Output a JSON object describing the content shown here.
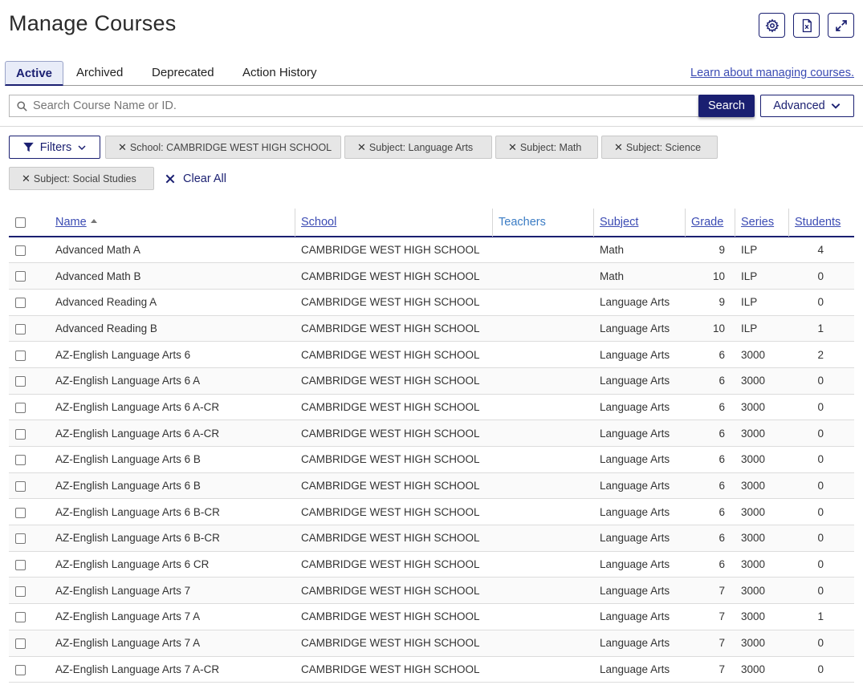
{
  "header": {
    "title": "Manage Courses"
  },
  "tabs": [
    {
      "label": "Active",
      "active": true
    },
    {
      "label": "Archived",
      "active": false
    },
    {
      "label": "Deprecated",
      "active": false
    },
    {
      "label": "Action History",
      "active": false
    }
  ],
  "learn_link": "Learn about managing courses.",
  "search": {
    "placeholder": "Search Course Name or ID.",
    "value": "",
    "button": "Search",
    "advanced": "Advanced"
  },
  "filters": {
    "button": "Filters",
    "chips": [
      "School: CAMBRIDGE WEST HIGH SCHOOL",
      "Subject: Language Arts",
      "Subject: Math",
      "Subject: Science",
      "Subject: Social Studies"
    ],
    "clear_all": "Clear All"
  },
  "table": {
    "columns": [
      "Name",
      "School",
      "Teachers",
      "Subject",
      "Grade",
      "Series",
      "Students"
    ],
    "rows": [
      [
        "Advanced Math A",
        "CAMBRIDGE WEST HIGH SCHOOL",
        "",
        "Math",
        "9",
        "ILP",
        "4"
      ],
      [
        "Advanced Math B",
        "CAMBRIDGE WEST HIGH SCHOOL",
        "",
        "Math",
        "10",
        "ILP",
        "0"
      ],
      [
        "Advanced Reading A",
        "CAMBRIDGE WEST HIGH SCHOOL",
        "",
        "Language Arts",
        "9",
        "ILP",
        "0"
      ],
      [
        "Advanced Reading B",
        "CAMBRIDGE WEST HIGH SCHOOL",
        "",
        "Language Arts",
        "10",
        "ILP",
        "1"
      ],
      [
        "AZ-English Language Arts 6",
        "CAMBRIDGE WEST HIGH SCHOOL",
        "",
        "Language Arts",
        "6",
        "3000",
        "2"
      ],
      [
        "AZ-English Language Arts 6 A",
        "CAMBRIDGE WEST HIGH SCHOOL",
        "",
        "Language Arts",
        "6",
        "3000",
        "0"
      ],
      [
        "AZ-English Language Arts 6 A-CR",
        "CAMBRIDGE WEST HIGH SCHOOL",
        "",
        "Language Arts",
        "6",
        "3000",
        "0"
      ],
      [
        "AZ-English Language Arts 6 A-CR",
        "CAMBRIDGE WEST HIGH SCHOOL",
        "",
        "Language Arts",
        "6",
        "3000",
        "0"
      ],
      [
        "AZ-English Language Arts 6 B",
        "CAMBRIDGE WEST HIGH SCHOOL",
        "",
        "Language Arts",
        "6",
        "3000",
        "0"
      ],
      [
        "AZ-English Language Arts 6 B",
        "CAMBRIDGE WEST HIGH SCHOOL",
        "",
        "Language Arts",
        "6",
        "3000",
        "0"
      ],
      [
        "AZ-English Language Arts 6 B-CR",
        "CAMBRIDGE WEST HIGH SCHOOL",
        "",
        "Language Arts",
        "6",
        "3000",
        "0"
      ],
      [
        "AZ-English Language Arts 6 B-CR",
        "CAMBRIDGE WEST HIGH SCHOOL",
        "",
        "Language Arts",
        "6",
        "3000",
        "0"
      ],
      [
        "AZ-English Language Arts 6 CR",
        "CAMBRIDGE WEST HIGH SCHOOL",
        "",
        "Language Arts",
        "6",
        "3000",
        "0"
      ],
      [
        "AZ-English Language Arts 7",
        "CAMBRIDGE WEST HIGH SCHOOL",
        "",
        "Language Arts",
        "7",
        "3000",
        "0"
      ],
      [
        "AZ-English Language Arts 7 A",
        "CAMBRIDGE WEST HIGH SCHOOL",
        "",
        "Language Arts",
        "7",
        "3000",
        "1"
      ],
      [
        "AZ-English Language Arts 7 A",
        "CAMBRIDGE WEST HIGH SCHOOL",
        "",
        "Language Arts",
        "7",
        "3000",
        "0"
      ],
      [
        "AZ-English Language Arts 7 A-CR",
        "CAMBRIDGE WEST HIGH SCHOOL",
        "",
        "Language Arts",
        "7",
        "3000",
        "0"
      ]
    ]
  },
  "icons": {
    "settings": "gear-icon",
    "export": "excel-export-icon",
    "expand": "expand-icon",
    "search": "search-icon",
    "filter": "filter-icon",
    "clear": "close-icon",
    "advanced": "chevron-down-icon"
  },
  "colors": {
    "primary": "#1a1f71",
    "link": "#3b4bb3"
  }
}
